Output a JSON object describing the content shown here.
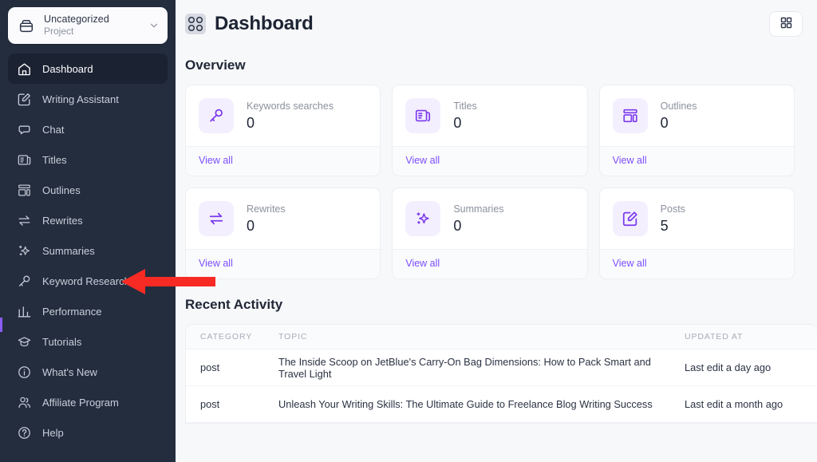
{
  "sidebar": {
    "project": {
      "name": "Uncategorized",
      "subtitle": "Project",
      "icon": "archive-box-icon",
      "chevron": "chevron-down-icon"
    },
    "items": [
      {
        "label": "Dashboard",
        "icon": "home-icon",
        "active": true
      },
      {
        "label": "Writing Assistant",
        "icon": "pencil-square-icon",
        "active": false
      },
      {
        "label": "Chat",
        "icon": "chat-bubble-icon",
        "active": false
      },
      {
        "label": "Titles",
        "icon": "newspaper-icon",
        "active": false
      },
      {
        "label": "Outlines",
        "icon": "layout-icon",
        "active": false
      },
      {
        "label": "Rewrites",
        "icon": "arrows-exchange-icon",
        "active": false
      },
      {
        "label": "Summaries",
        "icon": "sparkles-icon",
        "active": false
      },
      {
        "label": "Keyword Research",
        "icon": "key-icon",
        "active": false
      },
      {
        "label": "Performance",
        "icon": "bar-chart-icon",
        "active": false
      },
      {
        "label": "Tutorials",
        "icon": "graduation-cap-icon",
        "active": false
      },
      {
        "label": "What's New",
        "icon": "info-circle-icon",
        "active": false
      },
      {
        "label": "Affiliate Program",
        "icon": "users-icon",
        "active": false
      },
      {
        "label": "Help",
        "icon": "question-circle-icon",
        "active": false
      }
    ]
  },
  "header": {
    "title": "Dashboard",
    "title_icon": "dashboard-grid-icon",
    "grid_button_icon": "grid-squares-icon"
  },
  "overview": {
    "section_title": "Overview",
    "view_all_label": "View all",
    "cards": [
      {
        "label": "Keywords searches",
        "value": "0",
        "icon": "key-icon"
      },
      {
        "label": "Titles",
        "value": "0",
        "icon": "newspaper-icon"
      },
      {
        "label": "Outlines",
        "value": "0",
        "icon": "layout-icon"
      },
      {
        "label": "Rewrites",
        "value": "0",
        "icon": "arrows-exchange-icon"
      },
      {
        "label": "Summaries",
        "value": "0",
        "icon": "sparkles-icon"
      },
      {
        "label": "Posts",
        "value": "5",
        "icon": "pencil-square-icon"
      }
    ]
  },
  "recent_activity": {
    "section_title": "Recent Activity",
    "columns": [
      "CATEGORY",
      "TOPIC",
      "UPDATED AT"
    ],
    "rows": [
      {
        "category": "post",
        "topic": "The Inside Scoop on JetBlue's Carry-On Bag Dimensions: How to Pack Smart and Travel Light",
        "updated_at": "Last edit a day ago"
      },
      {
        "category": "post",
        "topic": "Unleash Your Writing Skills: The Ultimate Guide to Freelance Blog Writing Success",
        "updated_at": "Last edit a month ago"
      }
    ]
  },
  "annotation": {
    "type": "arrow-left",
    "color": "#f82a24",
    "points_to": "Keyword Research"
  },
  "colors": {
    "sidebar_bg": "#242d3e",
    "sidebar_active": "#1b2232",
    "accent_purple": "#7c4dff",
    "icon_tile_bg": "#f3effe",
    "page_bg": "#f7f8fa",
    "arrow_red": "#f82a24"
  }
}
